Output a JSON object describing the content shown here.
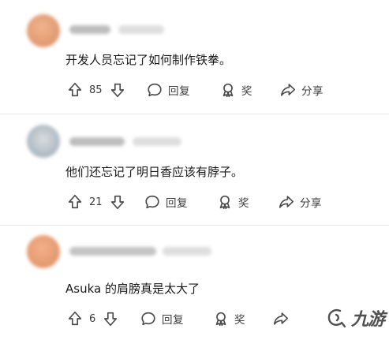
{
  "comments": [
    {
      "text": "开发人员忘记了如何制作铁拳。",
      "votes": "85",
      "reply_label": "回复",
      "award_label": "奖",
      "share_label": "分享",
      "avatar_color": "#e8a27a"
    },
    {
      "text": "他们还忘记了明日香应该有脖子。",
      "votes": "21",
      "reply_label": "回复",
      "award_label": "奖",
      "share_label": "分享",
      "avatar_color": "#b9c2cc"
    },
    {
      "text": "Asuka 的肩膀真是太大了",
      "votes": "6",
      "reply_label": "回复",
      "award_label": "奖",
      "share_label": ""
    }
  ],
  "icons": {
    "upvote": "arrow-up-outline",
    "downvote": "arrow-down-outline",
    "reply": "speech-bubble",
    "award": "award-ribbon",
    "share": "share-arrow"
  },
  "watermark": {
    "text": "九游"
  },
  "colors": {
    "text": "#1a1a1b",
    "icon": "#4a4a4a",
    "divider": "#e4e6ea"
  }
}
